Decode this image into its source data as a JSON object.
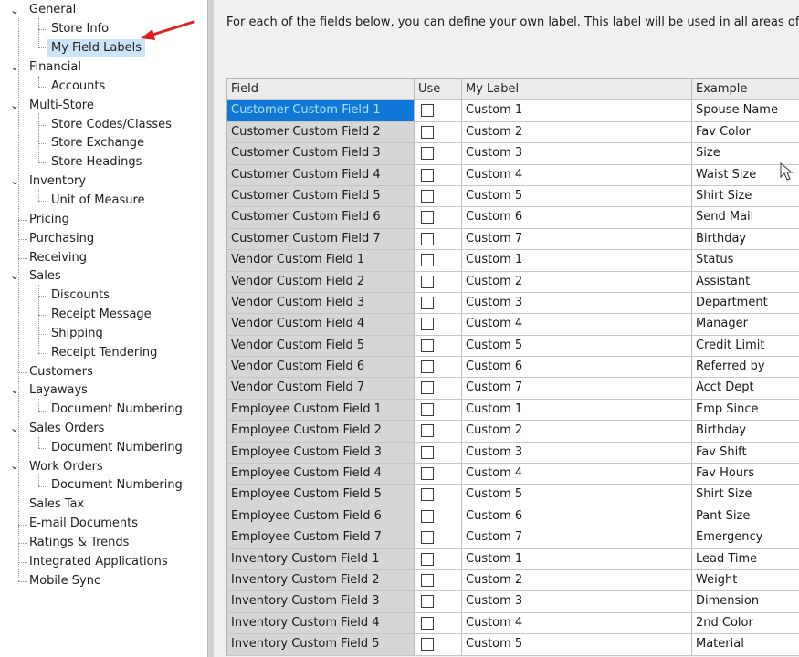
{
  "tree": {
    "items": [
      {
        "label": "General",
        "expanded": true
      },
      {
        "label": "Store Info"
      },
      {
        "label": "My Field Labels",
        "selected": true
      },
      {
        "label": "Financial",
        "expanded": true
      },
      {
        "label": "Accounts"
      },
      {
        "label": "Multi-Store",
        "expanded": true
      },
      {
        "label": "Store Codes/Classes"
      },
      {
        "label": "Store Exchange"
      },
      {
        "label": "Store Headings"
      },
      {
        "label": "Inventory",
        "expanded": true
      },
      {
        "label": "Unit of Measure"
      },
      {
        "label": "Pricing"
      },
      {
        "label": "Purchasing"
      },
      {
        "label": "Receiving"
      },
      {
        "label": "Sales",
        "expanded": true
      },
      {
        "label": "Discounts"
      },
      {
        "label": "Receipt Message"
      },
      {
        "label": "Shipping"
      },
      {
        "label": "Receipt Tendering"
      },
      {
        "label": "Customers"
      },
      {
        "label": "Layaways",
        "expanded": true
      },
      {
        "label": "Document Numbering"
      },
      {
        "label": "Sales Orders",
        "expanded": true
      },
      {
        "label": "Document Numbering"
      },
      {
        "label": "Work Orders",
        "expanded": true
      },
      {
        "label": "Document Numbering"
      },
      {
        "label": "Sales Tax"
      },
      {
        "label": "E-mail Documents"
      },
      {
        "label": "Ratings & Trends"
      },
      {
        "label": "Integrated Applications"
      },
      {
        "label": "Mobile Sync"
      }
    ]
  },
  "instructions": "For each of the fields below, you can define your own label. This label will be used in all areas of Point of",
  "grid": {
    "headers": {
      "field": "Field",
      "use": "Use",
      "label": "My Label",
      "example": "Example"
    },
    "rows": [
      {
        "field": "Customer Custom Field 1",
        "use": false,
        "label": "Custom 1",
        "example": "Spouse Name",
        "selected": true
      },
      {
        "field": "Customer Custom Field 2",
        "use": false,
        "label": "Custom 2",
        "example": "Fav Color"
      },
      {
        "field": "Customer Custom Field 3",
        "use": false,
        "label": "Custom 3",
        "example": "Size"
      },
      {
        "field": "Customer Custom Field 4",
        "use": false,
        "label": "Custom 4",
        "example": "Waist Size"
      },
      {
        "field": "Customer Custom Field 5",
        "use": false,
        "label": "Custom 5",
        "example": "Shirt Size"
      },
      {
        "field": "Customer Custom Field 6",
        "use": false,
        "label": "Custom 6",
        "example": "Send Mail"
      },
      {
        "field": "Customer Custom Field 7",
        "use": false,
        "label": "Custom 7",
        "example": "Birthday"
      },
      {
        "field": "Vendor Custom Field 1",
        "use": false,
        "label": "Custom 1",
        "example": "Status"
      },
      {
        "field": "Vendor Custom Field 2",
        "use": false,
        "label": "Custom 2",
        "example": "Assistant"
      },
      {
        "field": "Vendor Custom Field 3",
        "use": false,
        "label": "Custom 3",
        "example": "Department"
      },
      {
        "field": "Vendor Custom Field 4",
        "use": false,
        "label": "Custom 4",
        "example": "Manager"
      },
      {
        "field": "Vendor Custom Field 5",
        "use": false,
        "label": "Custom 5",
        "example": "Credit Limit"
      },
      {
        "field": "Vendor Custom Field 6",
        "use": false,
        "label": "Custom 6",
        "example": "Referred by"
      },
      {
        "field": "Vendor Custom Field 7",
        "use": false,
        "label": "Custom 7",
        "example": "Acct Dept"
      },
      {
        "field": "Employee Custom Field 1",
        "use": false,
        "label": "Custom 1",
        "example": "Emp Since"
      },
      {
        "field": "Employee Custom Field 2",
        "use": false,
        "label": "Custom 2",
        "example": "Birthday"
      },
      {
        "field": "Employee Custom Field 3",
        "use": false,
        "label": "Custom 3",
        "example": "Fav Shift"
      },
      {
        "field": "Employee Custom Field 4",
        "use": false,
        "label": "Custom 4",
        "example": "Fav Hours"
      },
      {
        "field": "Employee Custom Field 5",
        "use": false,
        "label": "Custom 5",
        "example": "Shirt Size"
      },
      {
        "field": "Employee Custom Field 6",
        "use": false,
        "label": "Custom 6",
        "example": "Pant Size"
      },
      {
        "field": "Employee Custom Field 7",
        "use": false,
        "label": "Custom 7",
        "example": "Emergency"
      },
      {
        "field": "Inventory Custom Field 1",
        "use": false,
        "label": "Custom 1",
        "example": "Lead Time"
      },
      {
        "field": "Inventory Custom Field 2",
        "use": false,
        "label": "Custom 2",
        "example": "Weight"
      },
      {
        "field": "Inventory Custom Field 3",
        "use": false,
        "label": "Custom 3",
        "example": "Dimension"
      },
      {
        "field": "Inventory Custom Field 4",
        "use": false,
        "label": "Custom 4",
        "example": "2nd Color"
      },
      {
        "field": "Inventory Custom Field 5",
        "use": false,
        "label": "Custom 5",
        "example": "Material"
      }
    ]
  },
  "colors": {
    "selection": "#0f78d6",
    "tree_selection": "#cce4f7",
    "arrow": "#e01f1f"
  },
  "icons": {
    "expander": "chevron-down-icon",
    "annotation": "red-arrow-icon",
    "pointer": "mouse-cursor-icon"
  }
}
